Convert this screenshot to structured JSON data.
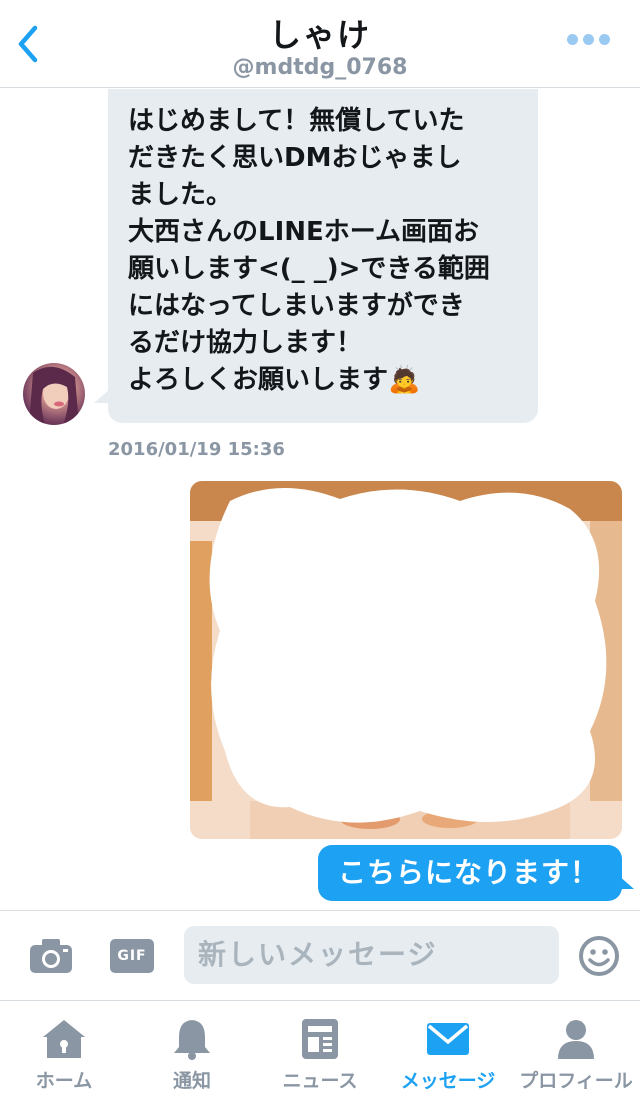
{
  "header": {
    "title": "しゃけ",
    "handle": "@mdtdg_0768",
    "back_icon": "chevron-left-icon",
    "more_icon": "more-dots-icon"
  },
  "messages": {
    "incoming": {
      "lines": [
        "はじめまして！無償していた",
        "だきたく思いDMおじゃまし",
        "ました。",
        "大西さんのLINEホーム画面お",
        "願いします<(_ _)>できる範囲",
        "にはなってしまいますができ",
        "るだけ協力します！",
        "よろしくお願いします🙇"
      ],
      "timestamp": "2016/01/19 15:36"
    },
    "outgoing_text": "こちらになります！"
  },
  "composer": {
    "gif_label": "GIF",
    "placeholder": "新しいメッセージ"
  },
  "tabs": [
    {
      "label": "ホーム",
      "icon": "home-icon",
      "active": false
    },
    {
      "label": "通知",
      "icon": "bell-icon",
      "active": false
    },
    {
      "label": "ニュース",
      "icon": "news-icon",
      "active": false
    },
    {
      "label": "メッセージ",
      "icon": "envelope-icon",
      "active": true
    },
    {
      "label": "プロフィール",
      "icon": "profile-icon",
      "active": false
    }
  ],
  "colors": {
    "accent": "#1da1f2",
    "muted": "#8a96a3",
    "bubble_in": "#e6ecf0"
  }
}
